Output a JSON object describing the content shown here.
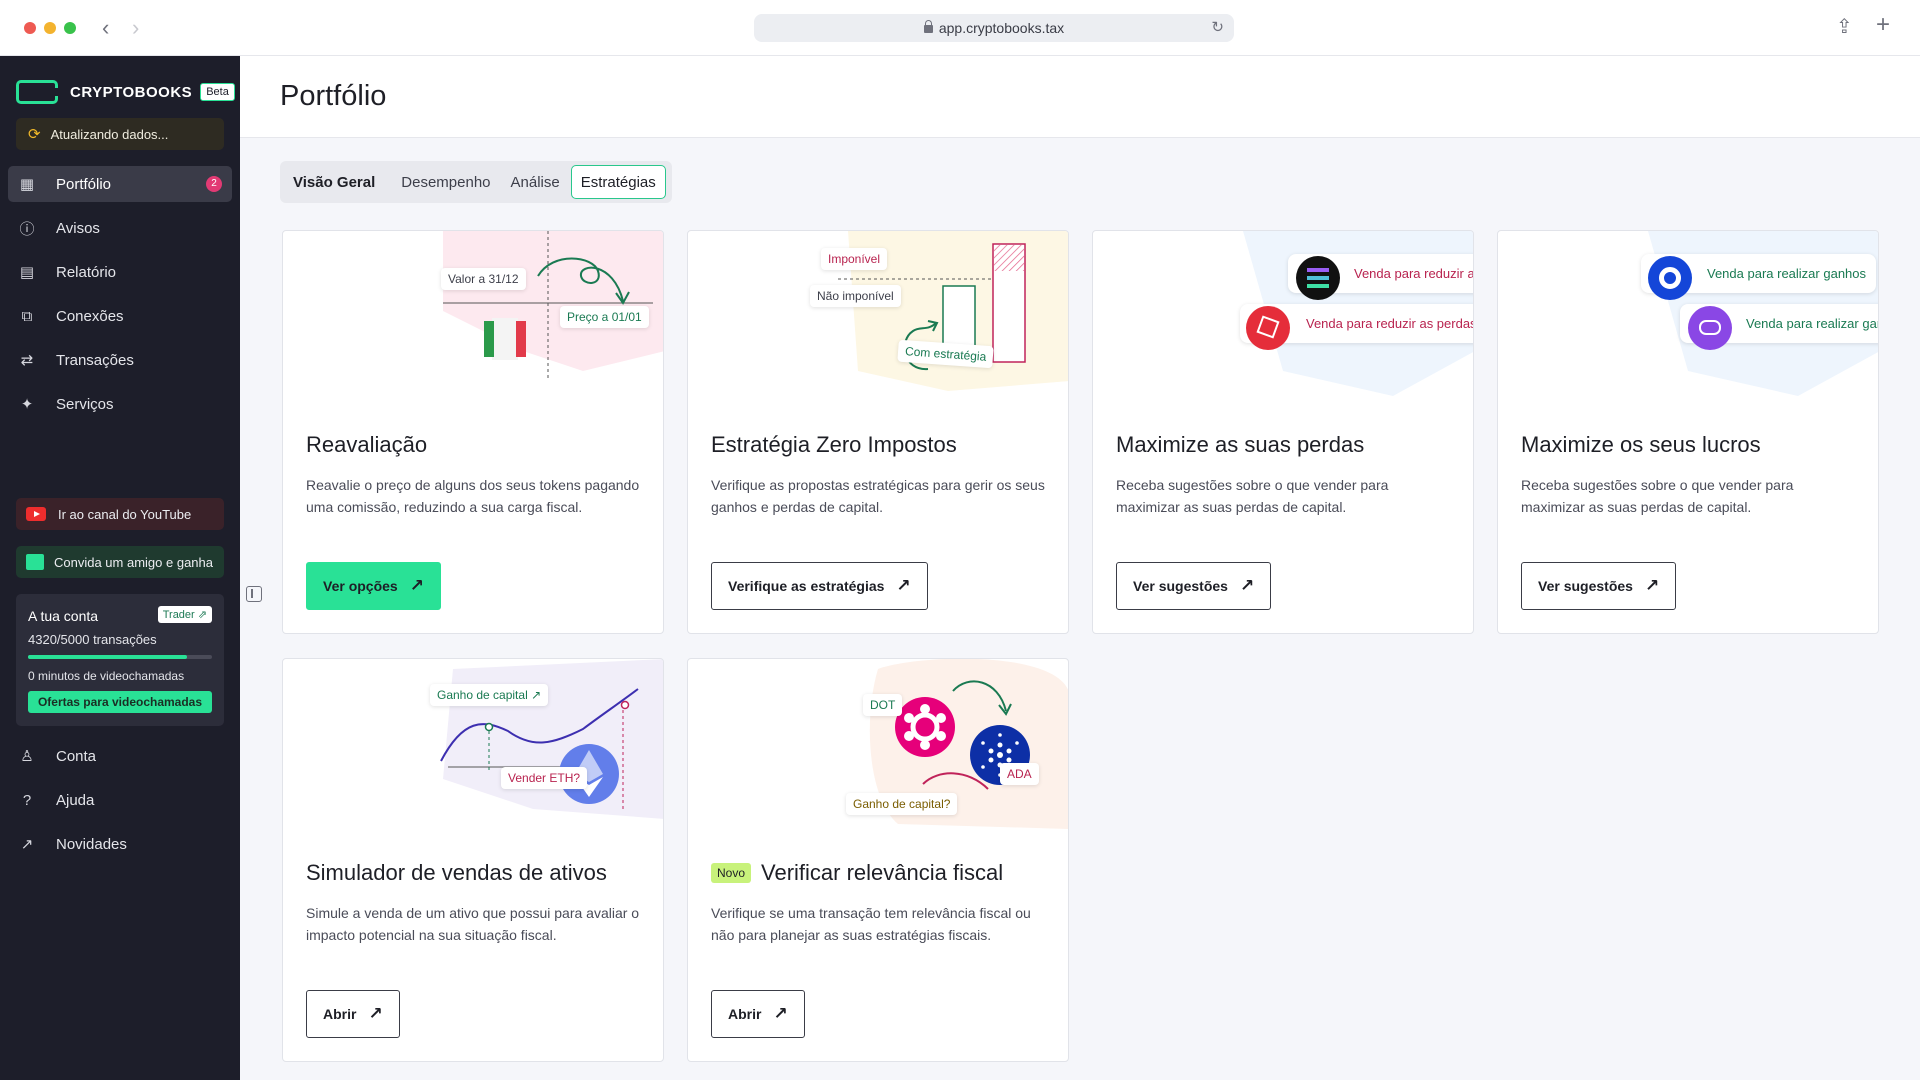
{
  "browser": {
    "url": "app.cryptobooks.tax"
  },
  "sidebar": {
    "brand": "CRYPTOBOOKS",
    "beta": "Beta",
    "sync_status": "Atualizando dados...",
    "nav": [
      {
        "label": "Portfólio",
        "icon": "grid-icon",
        "badge": "2",
        "active": true
      },
      {
        "label": "Avisos",
        "icon": "alert-icon"
      },
      {
        "label": "Relatório",
        "icon": "report-icon"
      },
      {
        "label": "Conexões",
        "icon": "connections-icon"
      },
      {
        "label": "Transações",
        "icon": "transactions-icon"
      },
      {
        "label": "Serviços",
        "icon": "sparkles-icon"
      }
    ],
    "promo_youtube": "Ir ao canal do YouTube",
    "promo_friend": "Convida um amigo e ganha",
    "account": {
      "title": "A tua conta",
      "plan": "Trader",
      "transactions": "4320/5000 transações",
      "transactions_used": 4320,
      "transactions_limit": 5000,
      "video_minutes": "0 minutos de videochamadas",
      "offer_button": "Ofertas para videochamadas"
    },
    "bottom_nav": [
      {
        "label": "Conta",
        "icon": "user-icon"
      },
      {
        "label": "Ajuda",
        "icon": "help-icon"
      },
      {
        "label": "Novidades",
        "icon": "arrow-up-right-icon"
      }
    ]
  },
  "main": {
    "title": "Portfólio",
    "tabs": [
      "Visão Geral",
      "Desempenho",
      "Análise",
      "Estratégias"
    ],
    "active_tab": "Estratégias",
    "cards": [
      {
        "title": "Reavaliação",
        "description": "Reavalie o preço de alguns dos seus tokens pagando uma comissão, reduzindo a sua carga fiscal.",
        "button": "Ver opções",
        "art": {
          "chip1": "Valor a 31/12",
          "chip2": "Preço a 01/01"
        }
      },
      {
        "title": "Estratégia Zero Impostos",
        "description": "Verifique as propostas estratégicas para gerir os seus ganhos e perdas de capital.",
        "button": "Verifique as estratégias",
        "art": {
          "chip1": "Imponível",
          "chip2": "Não imponível",
          "chip3": "Com estratégia"
        }
      },
      {
        "title": "Maximize as suas perdas",
        "description": "Receba sugestões sobre o que vender para maximizar as suas perdas de capital.",
        "button": "Ver sugestões",
        "art": {
          "chip1": "Venda para reduzir as",
          "chip2": "Venda para reduzir as perdas"
        }
      },
      {
        "title": "Maximize os seus lucros",
        "description": "Receba sugestões sobre o que vender para maximizar as suas perdas de capital.",
        "button": "Ver sugestões",
        "art": {
          "chip1": "Venda para realizar ganhos",
          "chip2": "Venda para realizar gar"
        }
      },
      {
        "title": "Simulador de vendas de ativos",
        "description": "Simule a venda de um ativo que possui para avaliar o impacto potencial na sua situação fiscal.",
        "button": "Abrir",
        "art": {
          "chip1": "Ganho de capital",
          "chip2": "Vender ETH?"
        }
      },
      {
        "title": "Verificar relevância fiscal",
        "badge": "Novo",
        "description": "Verifique se uma transação tem relevância fiscal ou não para planejar as suas estratégias fiscais.",
        "button": "Abrir",
        "art": {
          "chip1": "DOT",
          "chip2": "ADA",
          "chip3": "Ganho de capital?"
        }
      }
    ]
  },
  "colors": {
    "accent": "#29e196",
    "sidebar_bg": "#1d1e2a",
    "badge": "#e23a74"
  }
}
